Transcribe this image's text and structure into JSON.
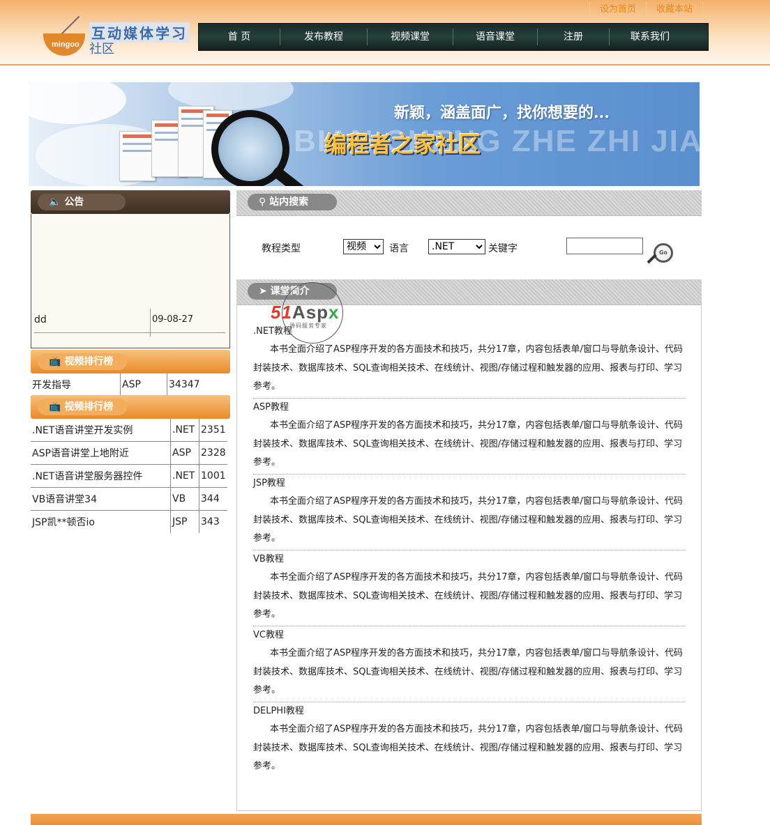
{
  "header": {
    "toplinks": [
      "设为首页",
      "收藏本站"
    ],
    "logo": {
      "line1": "互动媒体学习",
      "line2": "社区",
      "bowl_text": "mingoo"
    },
    "nav": [
      "首 页",
      "发布教程",
      "视频课堂",
      "语音课堂",
      "注册",
      "联系我们"
    ]
  },
  "banner": {
    "slogan": "新颖，涵盖面广，找你想要的...",
    "title": "编程者之家社区",
    "bg_text": "BIAN CHENG ZHE ZHI JIA"
  },
  "notice": {
    "title": "公告",
    "items": [
      {
        "title": "dd",
        "date": "09-08-27"
      }
    ]
  },
  "rank1": {
    "title": "视频排行榜",
    "rows": [
      [
        "开发指导",
        "ASP",
        "34347"
      ]
    ]
  },
  "rank2": {
    "title": "视频排行榜",
    "rows": [
      [
        ".NET语音讲堂开发实例",
        ".NET",
        "2351"
      ],
      [
        "ASP语音讲堂上地附近",
        "ASP",
        "2328"
      ],
      [
        ".NET语音讲堂服务器控件",
        ".NET",
        "1001"
      ],
      [
        "VB语音讲堂34",
        "VB",
        "344"
      ],
      [
        "JSP凯**顿否io",
        "JSP",
        "343"
      ]
    ]
  },
  "search": {
    "title": "站内搜索",
    "type_label": "教程类型",
    "type_value": "视频",
    "lang_label": "语言",
    "lang_value": ".NET",
    "keyword_label": "关键字",
    "keyword_value": "",
    "go_text": "Go"
  },
  "intro": {
    "title": "课堂简介",
    "courses": [
      {
        "title": ".NET教程",
        "desc": "本书全面介绍了ASP程序开发的各方面技术和技巧，共分17章，内容包括表单/窗口与导航条设计、代码封装技术、数据库技术、SQL查询相关技术、在线统计、视图/存储过程和触发器的应用、报表与打印、学习参考。"
      },
      {
        "title": "ASP教程",
        "desc": "本书全面介绍了ASP程序开发的各方面技术和技巧，共分17章，内容包括表单/窗口与导航条设计、代码封装技术、数据库技术、SQL查询相关技术、在线统计、视图/存储过程和触发器的应用、报表与打印、学习参考。"
      },
      {
        "title": "JSP教程",
        "desc": "本书全面介绍了ASP程序开发的各方面技术和技巧，共分17章，内容包括表单/窗口与导航条设计、代码封装技术、数据库技术、SQL查询相关技术、在线统计、视图/存储过程和触发器的应用、报表与打印、学习参考。"
      },
      {
        "title": "VB教程",
        "desc": "本书全面介绍了ASP程序开发的各方面技术和技巧，共分17章，内容包括表单/窗口与导航条设计、代码封装技术、数据库技术、SQL查询相关技术、在线统计、视图/存储过程和触发器的应用、报表与打印、学习参考。"
      },
      {
        "title": "VC教程",
        "desc": "本书全面介绍了ASP程序开发的各方面技术和技巧，共分17章，内容包括表单/窗口与导航条设计、代码封装技术、数据库技术、SQL查询相关技术、在线统计、视图/存储过程和触发器的应用、报表与打印、学习参考。"
      },
      {
        "title": "DELPHI教程",
        "desc": "本书全面介绍了ASP程序开发的各方面技术和技巧，共分17章，内容包括表单/窗口与导航条设计、代码封装技术、数据库技术、SQL查询相关技术、在线统计、视图/存储过程和触发器的应用、报表与打印、学习参考。"
      }
    ]
  },
  "watermark": {
    "brand_a": "51",
    "brand_b": "Asp",
    "brand_c": "x",
    "sub": "源码服务专家"
  }
}
